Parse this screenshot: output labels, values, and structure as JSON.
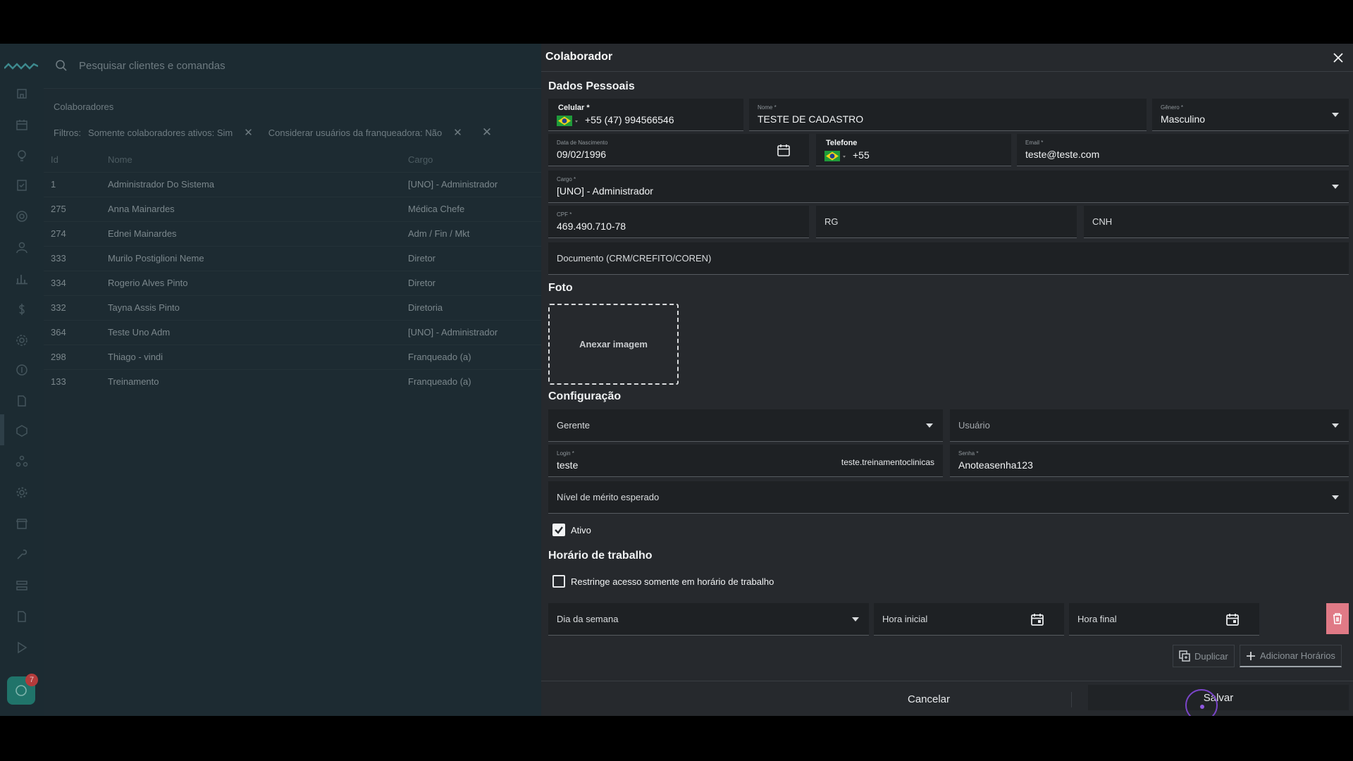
{
  "search": {
    "placeholder": "Pesquisar clientes e comandas"
  },
  "list": {
    "title": "Colaboradores",
    "filters_label": "Filtros:",
    "filters": [
      "Somente colaboradores ativos: Sim",
      "Considerar usuários da franqueadora: Não"
    ],
    "columns": [
      "Id",
      "Nome",
      "Cargo"
    ],
    "rows": [
      {
        "id": "1",
        "nome": "Administrador Do Sistema",
        "cargo": "[UNO] - Administrador"
      },
      {
        "id": "275",
        "nome": "Anna Mainardes",
        "cargo": "Médica Chefe"
      },
      {
        "id": "274",
        "nome": "Ednei Mainardes",
        "cargo": "Adm / Fin / Mkt"
      },
      {
        "id": "333",
        "nome": "Murilo Postiglioni Neme",
        "cargo": "Diretor"
      },
      {
        "id": "334",
        "nome": "Rogerio Alves Pinto",
        "cargo": "Diretor"
      },
      {
        "id": "332",
        "nome": "Tayna Assis Pinto",
        "cargo": "Diretoria"
      },
      {
        "id": "364",
        "nome": "Teste Uno Adm",
        "cargo": "[UNO] - Administrador"
      },
      {
        "id": "298",
        "nome": "Thiago - vindi",
        "cargo": "Franqueado (a)"
      },
      {
        "id": "133",
        "nome": "Treinamento",
        "cargo": "Franqueado (a)"
      }
    ]
  },
  "chat_badge": "7",
  "modal": {
    "title": "Colaborador",
    "dados_pessoais": {
      "title": "Dados Pessoais",
      "celular": {
        "label": "Celular *",
        "value": "+55 (47) 994566546"
      },
      "nome": {
        "label": "Nome *",
        "value": "TESTE DE CADASTRO"
      },
      "genero": {
        "label": "Gênero *",
        "value": "Masculino"
      },
      "nascimento": {
        "label": "Data de Nascimento",
        "value": "09/02/1996"
      },
      "telefone": {
        "label": "Telefone",
        "value": "+55"
      },
      "email": {
        "label": "Email *",
        "value": "teste@teste.com"
      },
      "cargo": {
        "label": "Cargo *",
        "value": "[UNO] - Administrador"
      },
      "cpf": {
        "label": "CPF *",
        "value": "469.490.710-78"
      },
      "rg": {
        "placeholder": "RG"
      },
      "cnh": {
        "placeholder": "CNH"
      },
      "documento": {
        "placeholder": "Documento (CRM/CREFITO/COREN)"
      }
    },
    "foto": {
      "title": "Foto",
      "dropzone": "Anexar imagem"
    },
    "configuracao": {
      "title": "Configuração",
      "perfil": "Gerente",
      "usuario": "Usuário",
      "login": {
        "label": "Login *",
        "value": "teste",
        "suffix": "teste.treinamentoclinicas"
      },
      "senha": {
        "label": "Senha *",
        "value": "Anoteasenha123"
      },
      "merito": "Nível de mérito esperado",
      "ativo": {
        "label": "Ativo",
        "checked": true
      }
    },
    "horario": {
      "title": "Horário de trabalho",
      "restringe": {
        "label": "Restringe acesso somente em horário de trabalho",
        "checked": false
      },
      "dia": "Dia da semana",
      "hora_inicial": "Hora inicial",
      "hora_final": "Hora final",
      "duplicar": "Duplicar",
      "adicionar": "Adicionar Horários"
    },
    "footer": {
      "cancel": "Cancelar",
      "save": "Salvar"
    }
  },
  "colors": {
    "accent_trash": "#e07a86",
    "flag_green": "#1f9b3a",
    "flag_yellow": "#f4d31a",
    "flag_blue": "#213f8f",
    "cursor": "#7a45c8"
  }
}
